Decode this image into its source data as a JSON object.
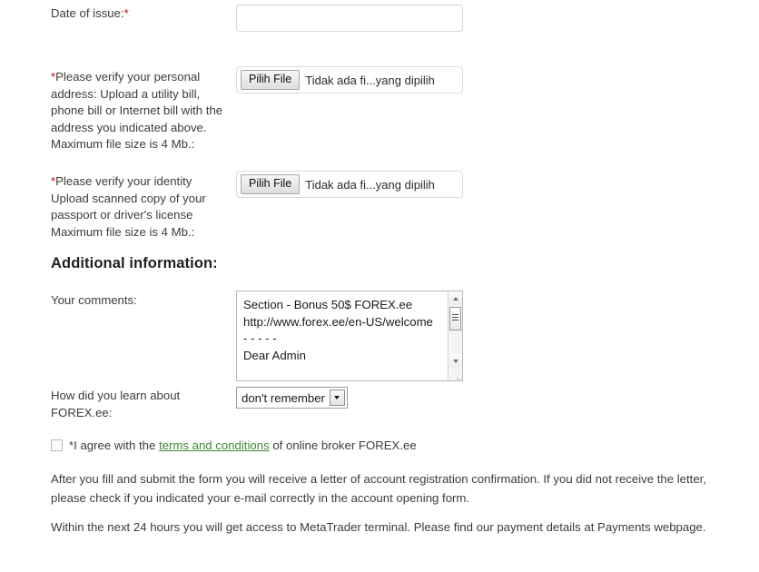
{
  "form": {
    "date_of_issue": {
      "label": "Date of issue:",
      "required_mark": "*",
      "value": "",
      "placeholder": ""
    },
    "address_proof": {
      "required_mark": "*",
      "label": "Please verify your personal address: Upload a utility bill, phone bill or Internet bill with the address you indicated above. Maximum file size is 4 Mb.:",
      "button_label": "Pilih File",
      "file_status": "Tidak ada fi...yang dipilih"
    },
    "identity_proof": {
      "required_mark": "*",
      "label": "Please verify your identity Upload scanned copy of your passport or driver's license Maximum file size is 4 Mb.:",
      "button_label": "Pilih File",
      "file_status": "Tidak ada fi...yang dipilih"
    },
    "additional_heading": "Additional information:",
    "comments": {
      "label": "Your comments:",
      "value": "Section - Bonus 50$ FOREX.ee http://www.forex.ee/en-US/welcome\n- - - - -\nDear Admin"
    },
    "referral": {
      "label": "How did you learn about FOREX.ee:",
      "selected": "don't remember",
      "options": [
        "don't remember"
      ]
    },
    "agreement": {
      "checked": false,
      "text_before": "*I agree with the",
      "link_text": "terms and conditions",
      "text_after": "of online broker FOREX.ee"
    }
  },
  "notes": {
    "paragraph_1": "After you fill and submit the form you will receive a letter of account registration confirmation. If you did not receive the letter, please check if you indicated your e-mail correctly in the account opening form.",
    "paragraph_2": "Within the next 24 hours you will get access to MetaTrader terminal. Please find our payment details at Payments webpage.",
    "paragraph_3": ""
  },
  "colors": {
    "required": "#cc0000",
    "link": "#3f8a33",
    "text": "#3c3c3c",
    "heading": "#1f1f1f",
    "background": "#ffffff"
  },
  "icons": {
    "scroll_up": "scroll-up-arrow-icon",
    "scroll_down": "scroll-down-arrow-icon",
    "dropdown": "chevron-down-icon",
    "resize": "resize-grip-icon"
  }
}
